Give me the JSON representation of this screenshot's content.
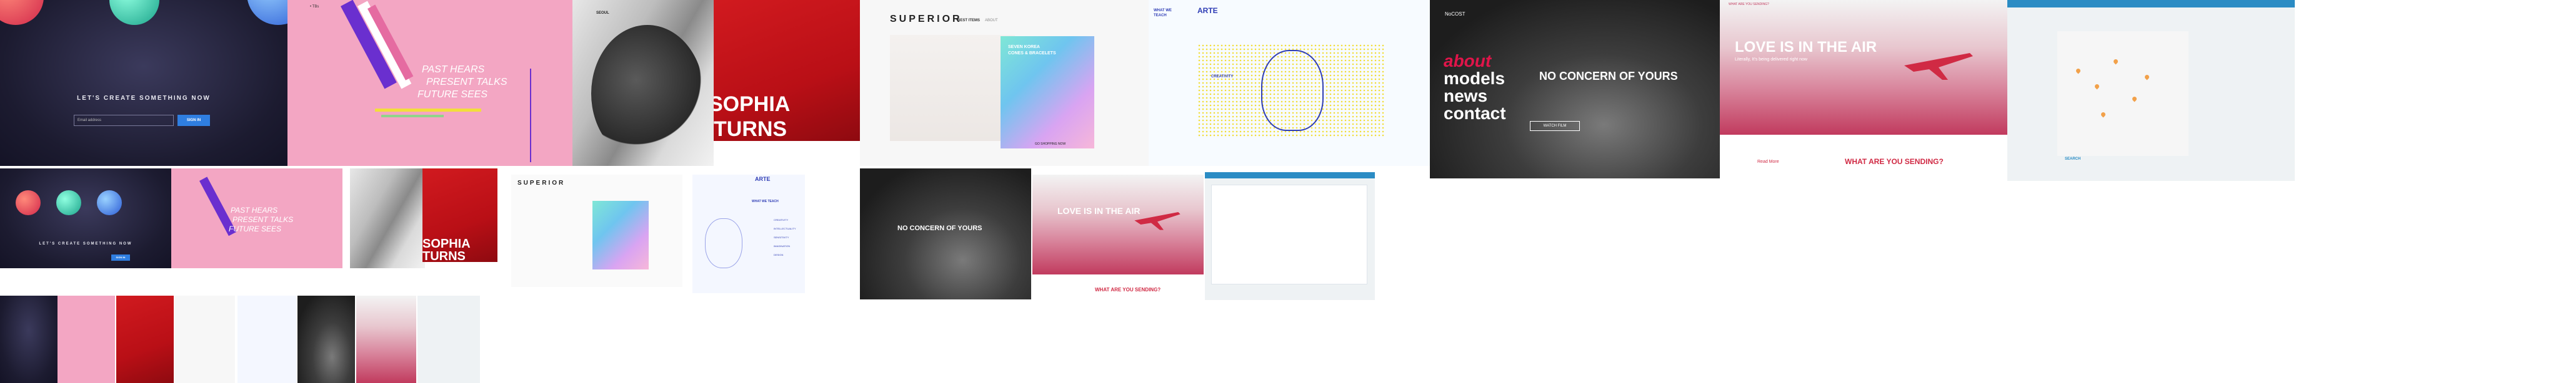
{
  "colors": {
    "dark_navy": "#1c1b30",
    "pink": "#f3a6c3",
    "red": "#c8141b",
    "blue_button": "#2f7ee0",
    "purple_text": "#7a2fd3",
    "arte_blue": "#2f3db5",
    "arte_yellow": "#f2de3b",
    "love_red": "#d02a44",
    "map_blue": "#2b8cc4",
    "pin_orange": "#f2a14a"
  },
  "create": {
    "headline": "LET'S CREATE SOMETHING NOW",
    "email_placeholder": "Email address",
    "button": "SIGN IN"
  },
  "past": {
    "nav_brand": "• TBs",
    "line1": "PAST HEARS",
    "line2": "PRESENT TALKS",
    "line3": "FUTURE SEES"
  },
  "sophia": {
    "brand": "SEOUL",
    "line1": "SOPHIA",
    "line2": "TURNS"
  },
  "superior": {
    "logo": "SUPERIOR",
    "tab1": "BEST ITEMS",
    "tab2": "ABOUT",
    "card_title_1": "SEVEN KOREA",
    "card_title_2": "CONES & BRACELETS",
    "cta": "GO SHOPPING NOW"
  },
  "arte": {
    "logo": "ARTE",
    "menu1": "WHAT WE",
    "menu2": "TEACH",
    "section": "WHAT WE TEACH",
    "creativity": "CREATIVITY",
    "subjects": [
      "CREATIVITY",
      "INTELLECTUALITY",
      "SENSITIVITY",
      "IMAGINATION",
      "DESIGN"
    ]
  },
  "nocost": {
    "brand": "NoCOST",
    "menu": [
      "about",
      "models",
      "news",
      "contact"
    ],
    "headline": "NO CONCERN OF YOURS",
    "button": "WATCH FILM"
  },
  "love": {
    "brand": "WHAT ARE YOU SENDING?",
    "headline": "LOVE IS IN THE AIR",
    "sub": "Literally, It's being delivered right now",
    "question": "WHAT ARE YOU SENDING?",
    "read_more": "Read More"
  },
  "map": {
    "title": "SEARCH"
  }
}
